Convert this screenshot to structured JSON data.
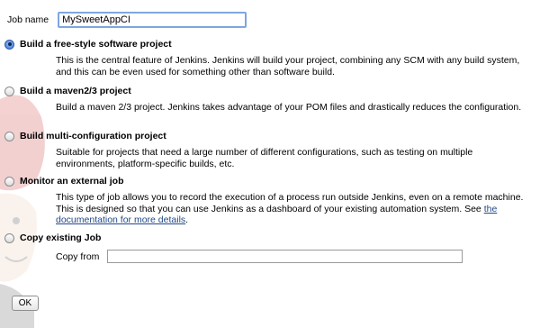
{
  "job": {
    "label": "Job name",
    "value": "MySweetAppCI"
  },
  "options": [
    {
      "title": "Build a free-style software project",
      "checked": true,
      "description": "This is the central feature of Jenkins. Jenkins will build your project, combining any SCM with any build system, and this can be even used for something other than software build."
    },
    {
      "title": "Build a maven2/3 project",
      "checked": false,
      "description": "Build a maven 2/3 project. Jenkins takes advantage of your POM files and drastically reduces the configuration."
    },
    {
      "title": "Build multi-configuration project",
      "checked": false,
      "description": "Suitable for projects that need a large number of different configurations, such as testing on multiple environments, platform-specific builds, etc."
    },
    {
      "title": "Monitor an external job",
      "checked": false,
      "description": "This type of job allows you to record the execution of a process run outside Jenkins, even on a remote machine. This is designed so that you can use Jenkins as a dashboard of your existing automation system. See ",
      "link_text": "the documentation for more details",
      "description_end": "."
    },
    {
      "title": "Copy existing Job",
      "checked": false
    }
  ],
  "copy_from": {
    "label": "Copy from",
    "value": ""
  },
  "ok_label": "OK",
  "icons": {
    "background": "jenkins-mascot-icon",
    "radio": "radio-button"
  },
  "colors": {
    "link": "#204a87",
    "focus_border": "#7fa6e0",
    "mascot_red": "#c9302c"
  }
}
